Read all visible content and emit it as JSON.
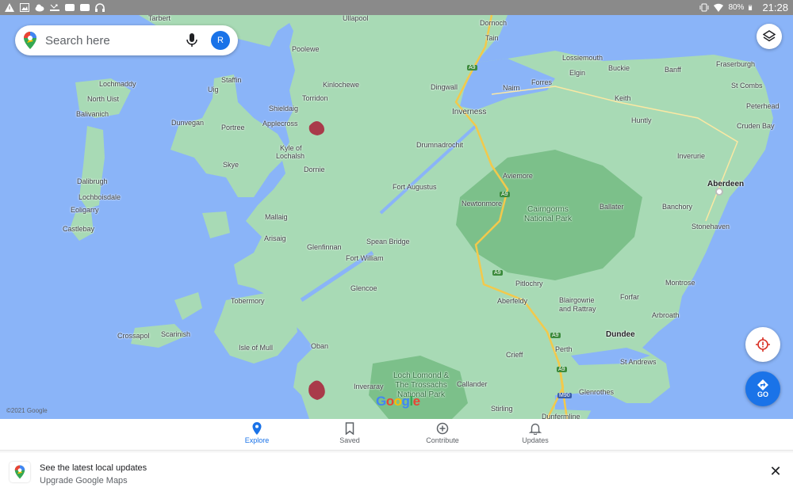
{
  "status_bar": {
    "time": "21:28",
    "battery": "80%",
    "left_icons": [
      "warning-icon",
      "gallery-icon",
      "cloud-icon",
      "missed-call-icon",
      "android-auto-icon",
      "android-auto-icon",
      "headset-icon"
    ],
    "right_icons": [
      "vibrate-icon",
      "wifi-icon",
      "battery-icon"
    ]
  },
  "search": {
    "placeholder": "Search here",
    "avatar_initial": "R"
  },
  "map": {
    "brand": [
      "G",
      "o",
      "o",
      "g",
      "l",
      "e"
    ],
    "copyright": "©2021 Google",
    "places": [
      {
        "label": "Tarbert"
      },
      {
        "label": "Ullapool"
      },
      {
        "label": "Dornoch"
      },
      {
        "label": "Tain"
      },
      {
        "label": "Poolewe"
      },
      {
        "label": "Staffin"
      },
      {
        "label": "Lochmaddy"
      },
      {
        "label": "Kinlochewe"
      },
      {
        "label": "Uig"
      },
      {
        "label": "North Uist"
      },
      {
        "label": "Torridon"
      },
      {
        "label": "Shieldaig"
      },
      {
        "label": "Balivanich"
      },
      {
        "label": "Applecross"
      },
      {
        "label": "Dunvegan"
      },
      {
        "label": "Portree"
      },
      {
        "label": "Kyle of"
      },
      {
        "label": "Lochalsh"
      },
      {
        "label": "Skye"
      },
      {
        "label": "Dornie"
      },
      {
        "label": "Dalibrugh"
      },
      {
        "label": "Lochboisdale"
      },
      {
        "label": "Eoligarry"
      },
      {
        "label": "Castlebay"
      },
      {
        "label": "Mallaig"
      },
      {
        "label": "Arisaig"
      },
      {
        "label": "Glenfinnan"
      },
      {
        "label": "Tobermory"
      },
      {
        "label": "Glencoe"
      },
      {
        "label": "Crossapol"
      },
      {
        "label": "Scarinish"
      },
      {
        "label": "Isle of Mull"
      },
      {
        "label": "Oban"
      },
      {
        "label": "Inveraray"
      },
      {
        "label": "Lossiemouth"
      },
      {
        "label": "Buckie"
      },
      {
        "label": "Fraserburgh"
      },
      {
        "label": "Elgin"
      },
      {
        "label": "Banff"
      },
      {
        "label": "Nairn"
      },
      {
        "label": "Forres"
      },
      {
        "label": "St Combs"
      },
      {
        "label": "Keith"
      },
      {
        "label": "Peterhead"
      },
      {
        "label": "Dingwall"
      },
      {
        "label": "Inverness"
      },
      {
        "label": "Huntly"
      },
      {
        "label": "Cruden Bay"
      },
      {
        "label": "Drumnadrochit"
      },
      {
        "label": "Inverurie"
      },
      {
        "label": "Aviemore"
      },
      {
        "label": "Fort Augustus"
      },
      {
        "label": "Aberdeen"
      },
      {
        "label": "Newtonmore"
      },
      {
        "label": "Ballater"
      },
      {
        "label": "Banchory"
      },
      {
        "label": "Stonehaven"
      },
      {
        "label": "Spean Bridge"
      },
      {
        "label": "Fort William"
      },
      {
        "label": "Pitlochry"
      },
      {
        "label": "Montrose"
      },
      {
        "label": "Aberfeldy"
      },
      {
        "label": "Blairgowrie"
      },
      {
        "label": "and Rattray"
      },
      {
        "label": "Forfar"
      },
      {
        "label": "Arbroath"
      },
      {
        "label": "Dundee"
      },
      {
        "label": "Perth"
      },
      {
        "label": "Crieff"
      },
      {
        "label": "St Andrews"
      },
      {
        "label": "Callander"
      },
      {
        "label": "Glenrothes"
      },
      {
        "label": "Stirling"
      },
      {
        "label": "Dunfermline"
      }
    ],
    "parks": [
      {
        "label": "Cairngorms National Park"
      },
      {
        "label": "Loch Lomond & The Trossachs National Park"
      }
    ],
    "roads": [
      {
        "label": "A9"
      },
      {
        "label": "A9"
      },
      {
        "label": "A9"
      },
      {
        "label": "A9"
      },
      {
        "label": "A9"
      },
      {
        "label": "M90"
      }
    ]
  },
  "buttons": {
    "go_label": "GO"
  },
  "bottom_nav": [
    {
      "label": "Explore",
      "icon": "location-pin-icon",
      "active": true
    },
    {
      "label": "Saved",
      "icon": "bookmark-icon",
      "active": false
    },
    {
      "label": "Contribute",
      "icon": "add-circle-icon",
      "active": false
    },
    {
      "label": "Updates",
      "icon": "bell-icon",
      "active": false
    }
  ],
  "banner": {
    "title": "See the latest local updates",
    "subtitle": "Upgrade Google Maps"
  },
  "colors": {
    "water": "#8ab4f8",
    "land": "#a8dab5",
    "park": "#7cc08a",
    "accent": "#1a73e8",
    "highway": "#f2c94c"
  }
}
